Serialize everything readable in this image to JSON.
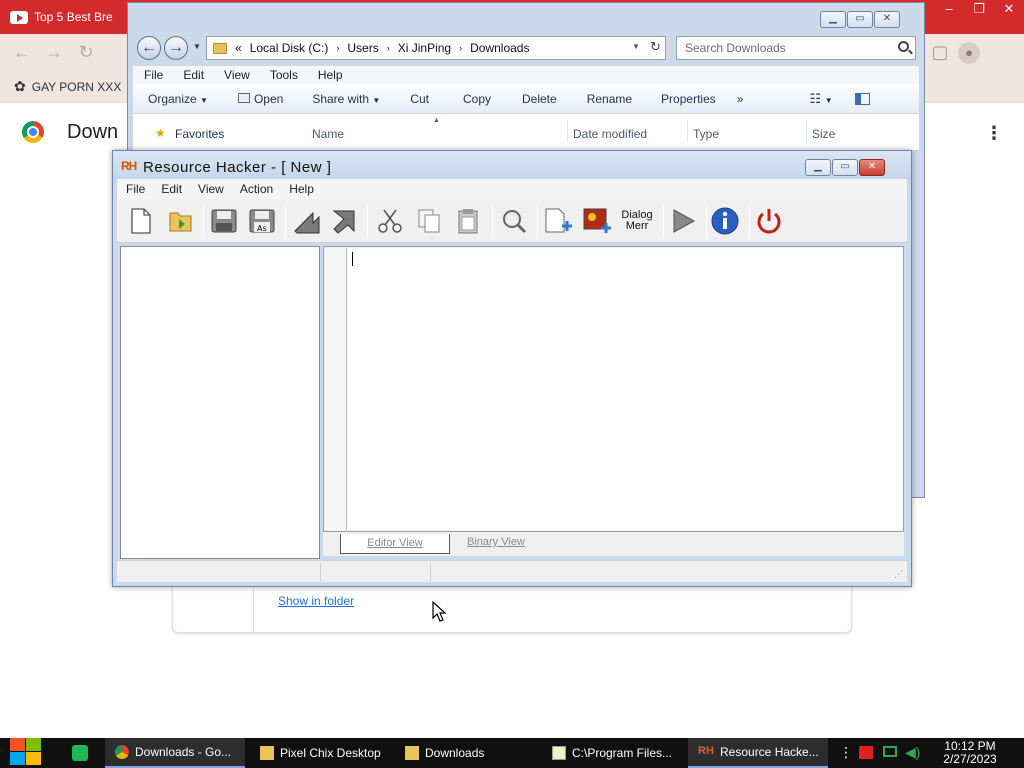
{
  "chrome": {
    "tab_title": "Top 5 Best Bre",
    "bookmark": "GAY PORN XXX",
    "page_title": "Down",
    "download_link": "Show in folder"
  },
  "explorer": {
    "breadcrumb_prefix": "«",
    "path": [
      "Local Disk (C:)",
      "Users",
      "Xi JinPing",
      "Downloads"
    ],
    "search_placeholder": "Search Downloads",
    "menu": [
      "File",
      "Edit",
      "View",
      "Tools",
      "Help"
    ],
    "commands": {
      "organize": "Organize",
      "open": "Open",
      "share_with": "Share with",
      "cut": "Cut",
      "copy": "Copy",
      "delete": "Delete",
      "rename": "Rename",
      "properties": "Properties",
      "overflow": "»"
    },
    "nav_favorites": "Favorites",
    "columns": {
      "name": "Name",
      "date_modified": "Date modified",
      "type": "Type",
      "size": "Size"
    }
  },
  "resource_hacker": {
    "logo": "RH",
    "title": "Resource Hacker - [ New ]",
    "menu": [
      "File",
      "Edit",
      "View",
      "Action",
      "Help"
    ],
    "toolbar": {
      "dialog_label_1": "Dialog",
      "dialog_label_2": "Merr"
    },
    "tabs": {
      "editor": "Editor View",
      "binary": "Binary View"
    }
  },
  "taskbar": {
    "items": [
      {
        "label": "Downloads - Go..."
      },
      {
        "label": "Pixel Chix Desktop"
      },
      {
        "label": "Downloads"
      },
      {
        "label": "C:\\Program Files..."
      },
      {
        "label": "Resource Hacke..."
      }
    ],
    "time": "10:12 PM",
    "date": "2/27/2023"
  },
  "colors": {
    "chrome_tab": "#d32b2b",
    "win7_chrome": "#ccd9ea",
    "taskbar": "#101010",
    "link": "#1a73e8"
  }
}
